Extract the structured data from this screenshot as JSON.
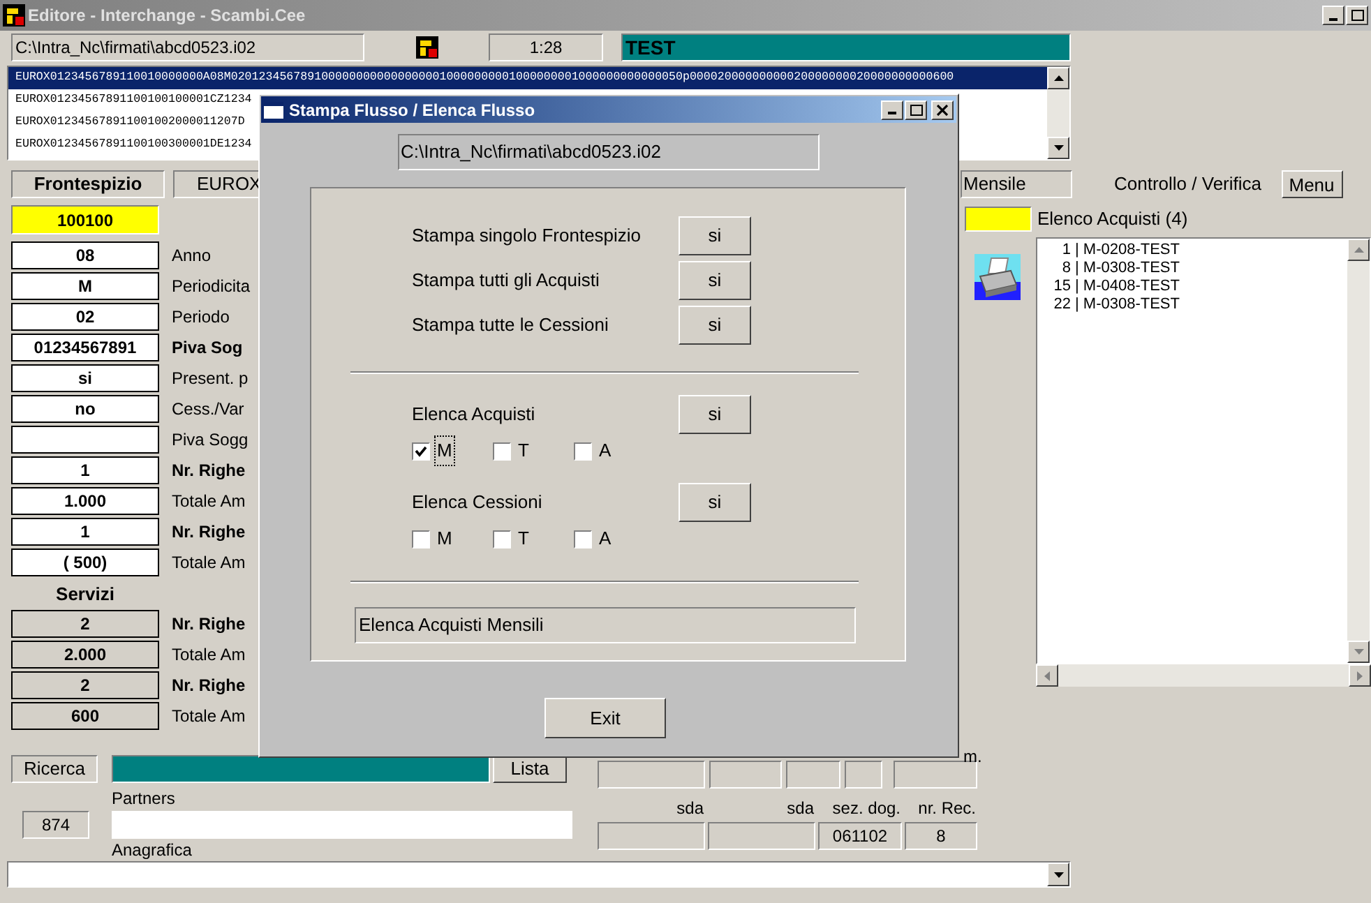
{
  "window": {
    "title": "Editore - Interchange - Scambi.Cee"
  },
  "toolbar": {
    "path": "C:\\Intra_Nc\\firmati\\abcd0523.i02",
    "time": "1:28",
    "status": "TEST"
  },
  "records": [
    {
      "text": "EUROX0123456789110010000000A08M02012345678910000000000000000010000000001000000001000000000000050p00002000000000020000000020000000000600",
      "selected": true
    },
    {
      "text": "EUROX01234567891100100100001CZ1234",
      "selected": false
    },
    {
      "text": "EUROX012345678911001002000011207D",
      "selected": false
    },
    {
      "text": "EUROX01234567891100100300001DE1234",
      "selected": false
    }
  ],
  "header": {
    "section": "Frontespizio",
    "code": "EUROX",
    "period_type": "Mensile",
    "check_label": "Controllo / Verifica",
    "menu_button": "Menu"
  },
  "frontespizio": {
    "code": "100100",
    "fields": [
      {
        "value": "08",
        "label": "Anno",
        "bold": false
      },
      {
        "value": "M",
        "label": "Periodicita",
        "bold": false
      },
      {
        "value": "02",
        "label": "Periodo",
        "bold": false
      },
      {
        "value": "01234567891",
        "label": "Piva Sog",
        "bold": true
      },
      {
        "value": "si",
        "label": "Present. p",
        "bold": false
      },
      {
        "value": "no",
        "label": "Cess./Var",
        "bold": false
      },
      {
        "label": "Piva Sogg",
        "bold": false
      },
      {
        "value": "1",
        "label": "Nr. Righe",
        "bold": true
      },
      {
        "value": "1.000",
        "label": "Totale Am",
        "bold": false
      },
      {
        "value": "1",
        "label": "Nr. Righe",
        "bold": true
      },
      {
        "value": "( 500)",
        "label": "Totale Am",
        "bold": false
      }
    ]
  },
  "servizi": {
    "title": "Servizi",
    "fields": [
      {
        "value": "2",
        "label": "Nr. Righe",
        "bold": true
      },
      {
        "value": "2.000",
        "label": "Totale Am",
        "bold": false
      },
      {
        "value": "2",
        "label": "Nr. Righe",
        "bold": true
      },
      {
        "value": "600",
        "label": "Totale Am",
        "bold": false
      }
    ]
  },
  "acquisti": {
    "title": "Elenco Acquisti (4)",
    "items": [
      {
        "number": "1",
        "code": "| M-0208-TEST"
      },
      {
        "number": "8",
        "code": "| M-0308-TEST"
      },
      {
        "number": "15",
        "code": "| M-0408-TEST"
      },
      {
        "number": "22",
        "code": "| M-0308-TEST"
      }
    ]
  },
  "search": {
    "label": "Ricerca",
    "list_button": "Lista",
    "partners_label": "Partners",
    "count": "874",
    "registry_label": "Anagrafica"
  },
  "customs": {
    "upper_label": "m.",
    "fields": [
      {
        "label": "sda"
      },
      {
        "label": "sda"
      },
      {
        "label": "sez. dog.",
        "value": "061102"
      },
      {
        "label": "nr. Rec.",
        "value": "8"
      }
    ]
  },
  "dialog": {
    "title": "Stampa Flusso / Elenca Flusso",
    "path": "C:\\Intra_Nc\\firmati\\abcd0523.i02",
    "print_rows": [
      {
        "label": "Stampa singolo Frontespizio",
        "button": "si"
      },
      {
        "label": "Stampa tutti gli Acquisti",
        "button": "si"
      },
      {
        "label": "Stampa tutte le Cessioni",
        "button": "si"
      }
    ],
    "list_groups": [
      {
        "label": "Elenca Acquisti",
        "button": "si",
        "options": [
          {
            "label": "M",
            "checked": true,
            "focused": true
          },
          {
            "label": "T",
            "checked": false,
            "focused": false
          },
          {
            "label": "A",
            "checked": false,
            "focused": false
          }
        ]
      },
      {
        "label": "Elenca Cessioni",
        "button": "si",
        "options": [
          {
            "label": "M",
            "checked": false,
            "focused": false
          },
          {
            "label": "T",
            "checked": false,
            "focused": false
          },
          {
            "label": "A",
            "checked": false,
            "focused": false
          }
        ]
      }
    ],
    "status": "Elenca Acquisti Mensili",
    "exit_button": "Exit"
  }
}
